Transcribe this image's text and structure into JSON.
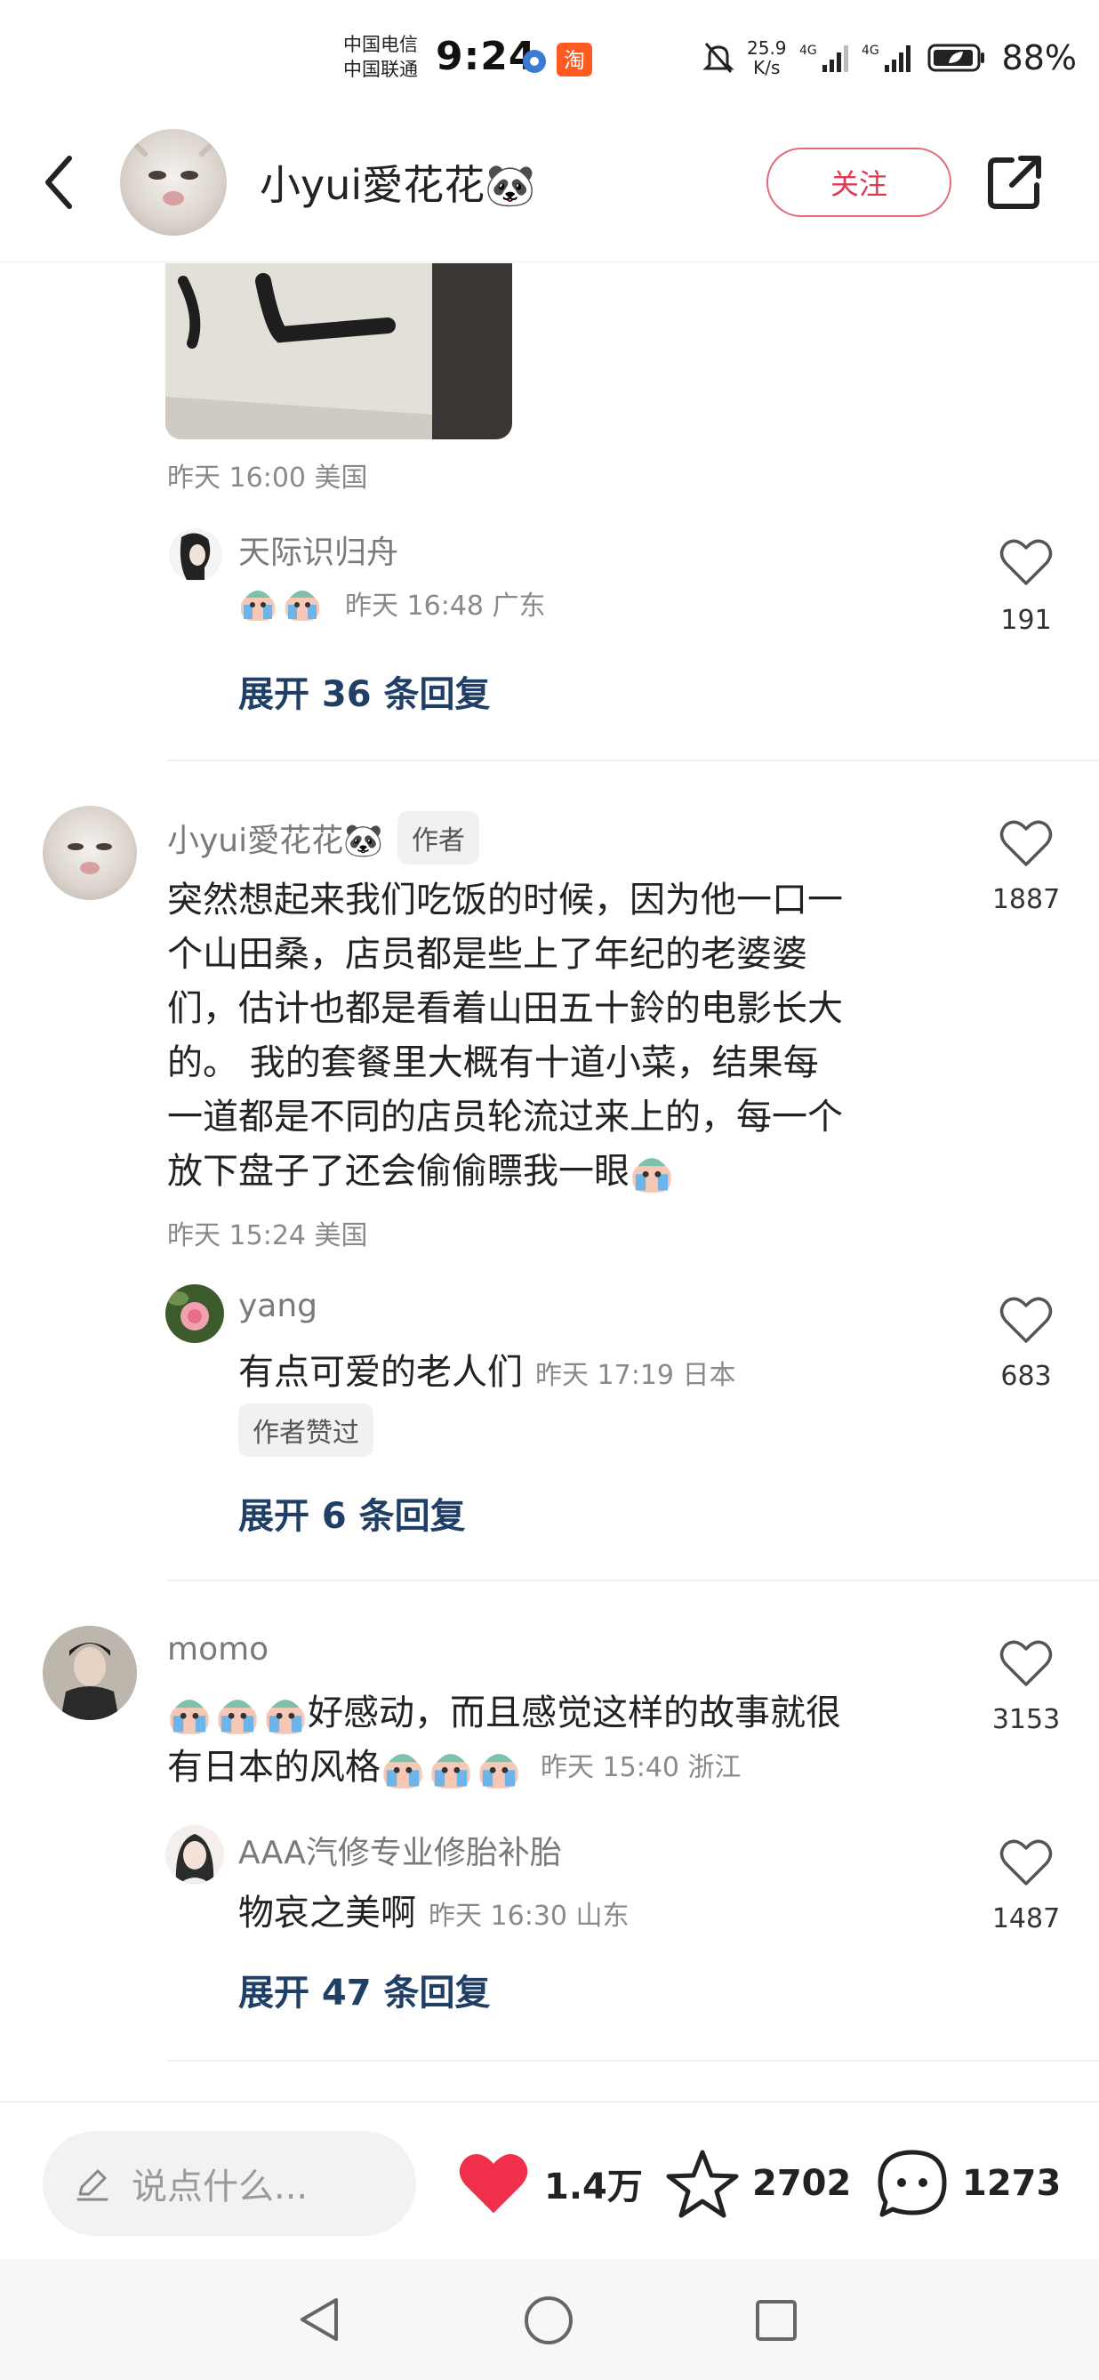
{
  "status_bar": {
    "carrier1": "中国电信",
    "carrier2": "中国联通",
    "time": "9:24",
    "speed": "25.9",
    "speed_unit": "K/s",
    "battery": "88%"
  },
  "header": {
    "title": "小yui愛花花🐼",
    "follow_label": "关注"
  },
  "post_meta": "昨天 16:00 美国",
  "thread1": {
    "reply_name": "天际识归舟",
    "reply_meta": "昨天 16:48 广东",
    "reply_likes": "191",
    "expand_label": "展开 36 条回复"
  },
  "comment2": {
    "name": "小yui愛花花🐼",
    "author_tag": "作者",
    "lines": [
      "突然想起来我们吃饭的时候，因为他一口一",
      "个山田桑，店员都是些上了年纪的老婆婆",
      "们，估计也都是看着山田五十鈴的电影长大",
      "的。 我的套餐里大概有十道小菜，结果每",
      "一道都是不同的店员轮流过来上的，每一个",
      "放下盘子了还会偷偷瞟我一眼"
    ],
    "meta": "昨天 15:24 美国",
    "likes": "1887",
    "reply_name": "yang",
    "reply_text": "有点可爱的老人们",
    "reply_meta": "昨天 17:19 日本",
    "reply_tag": "作者赞过",
    "reply_likes": "683",
    "expand_label": "展开 6 条回复"
  },
  "comment3": {
    "name": "momo",
    "line1": "好感动，而且感觉这样的故事就很",
    "line2": "有日本的风格",
    "meta": "昨天 15:40 浙江",
    "likes": "3153",
    "reply_name": "AAA汽修专业修胎补胎",
    "reply_text": "物哀之美啊",
    "reply_meta": "昨天 16:30 山东",
    "reply_likes": "1487",
    "expand_label": "展开 47 条回复"
  },
  "bottom_bar": {
    "input_placeholder": "说点什么...",
    "likes": "1.4万",
    "stars": "2702",
    "comments": "1273"
  },
  "colors": {
    "accent_red": "#e0384e",
    "expand_blue": "#1f3f66",
    "like_heart": "#f0304a"
  }
}
